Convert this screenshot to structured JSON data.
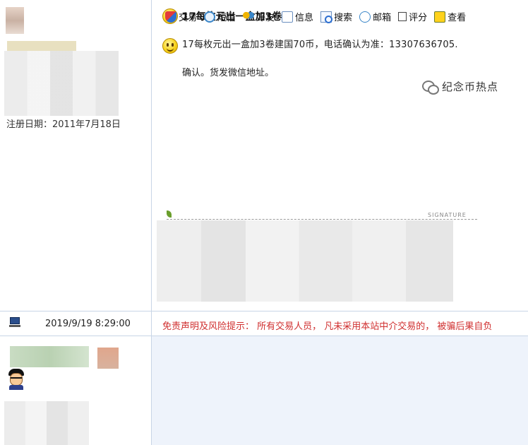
{
  "post1": {
    "user": {
      "reg_date": "注册日期：2011年7月18日"
    },
    "title": "17每枚元出一盒加3卷",
    "body": "17每枚元出一盒加3卷建国70币，电话确认为准：13307636705.",
    "signature_label": "SIGNATURE"
  },
  "meta": {
    "time": "2019/9/19 8:29:00",
    "disclaimer": "免责声明及风险提示： 所有交易人员， 凡未采用本站中介交易的， 被骗后果自负"
  },
  "post2": {
    "toolbar": [
      {
        "icon": "trade-icon",
        "label": "交易"
      },
      {
        "icon": "sms-icon",
        "label": "短信"
      },
      {
        "icon": "friend-icon",
        "label": "好友"
      },
      {
        "icon": "info-icon",
        "label": "信息"
      },
      {
        "icon": "search-icon",
        "label": "搜索"
      },
      {
        "icon": "mail-icon",
        "label": "邮箱"
      },
      {
        "icon": "rate-icon",
        "label": "评分"
      },
      {
        "icon": "view-icon",
        "label": "查看"
      }
    ],
    "body": "确认。货发微信地址。"
  },
  "watermark": "纪念币热点",
  "colors": {
    "border": "#c8d5e6",
    "reply_bg": "#eef3fb",
    "disclaimer": "#d03030"
  }
}
